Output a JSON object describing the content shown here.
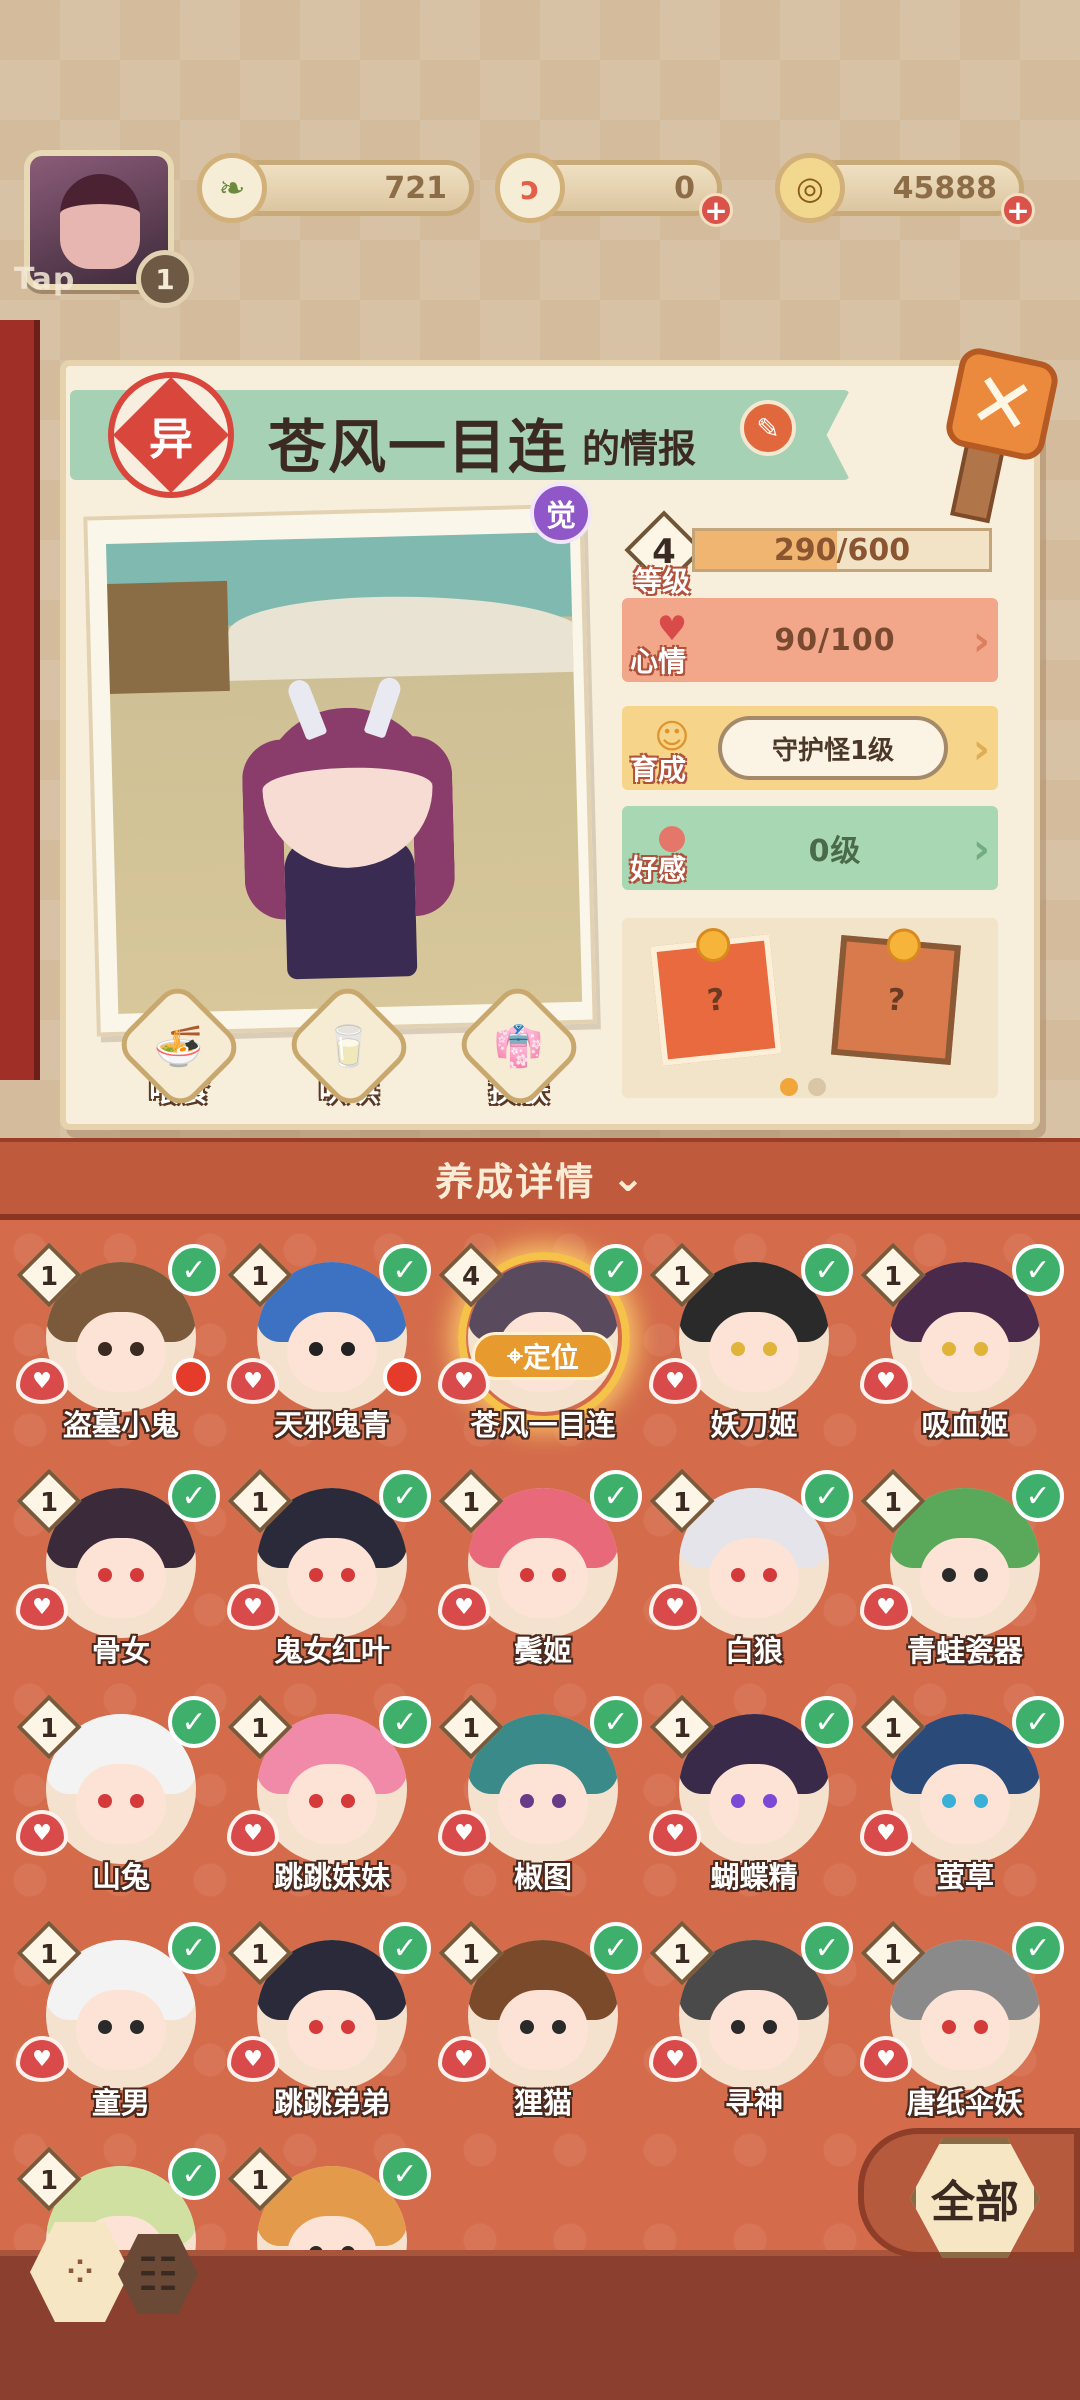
{
  "status": {
    "tap_label": "Tap",
    "player_level": "1",
    "resources": [
      {
        "name": "leaf",
        "icon": "leaf-currency-icon",
        "value": "721",
        "color": "#6c8a3c"
      },
      {
        "name": "magatama",
        "icon": "magatama-icon",
        "value": "0",
        "color": "#e2604a"
      },
      {
        "name": "coin",
        "icon": "coin-icon",
        "value": "45888",
        "color": "#c79a3c"
      }
    ]
  },
  "info": {
    "rarity_badge": "异",
    "name": "苍风一目连",
    "title_suffix": "的情报",
    "awaken_badge": "觉",
    "level": {
      "label": "等级",
      "value": "4",
      "exp": "290/600",
      "exp_fraction": 0.483
    },
    "mood": {
      "label": "心情",
      "value": "90/100"
    },
    "growth": {
      "label": "育成",
      "value": "守护怪1级"
    },
    "favor": {
      "label": "好感",
      "value": "0级"
    },
    "actions": [
      {
        "label": "喂食",
        "icon": "noodle-bowl-icon",
        "glyph": "🍜"
      },
      {
        "label": "哄哄",
        "icon": "milk-carton-icon",
        "glyph": "🥛"
      },
      {
        "label": "换肤",
        "icon": "kimono-icon",
        "glyph": "👘"
      }
    ],
    "gift_placeholder": "?",
    "pager_active": 0
  },
  "details_toggle": {
    "label": "养成详情"
  },
  "roster": [
    {
      "name": "盗墓小鬼",
      "level": "1",
      "hair": "#7a5a3a",
      "eye": "#3b2a22",
      "alert": true,
      "selected": false
    },
    {
      "name": "天邪鬼青",
      "level": "1",
      "hair": "#3d72c2",
      "eye": "#222222",
      "alert": true,
      "selected": false
    },
    {
      "name": "苍风一目连",
      "level": "4",
      "hair": "#5a4a5e",
      "eye": "#3b6fd6",
      "alert": false,
      "selected": true
    },
    {
      "name": "妖刀姬",
      "level": "1",
      "hair": "#2a2a2a",
      "eye": "#e0b43a",
      "alert": false,
      "selected": false
    },
    {
      "name": "吸血姬",
      "level": "1",
      "hair": "#4a2a4a",
      "eye": "#e0b43a",
      "alert": false,
      "selected": false
    },
    {
      "name": "骨女",
      "level": "1",
      "hair": "#3b2a3a",
      "eye": "#d43a3a",
      "alert": false,
      "selected": false
    },
    {
      "name": "鬼女红叶",
      "level": "1",
      "hair": "#2a2a3a",
      "eye": "#d43a3a",
      "alert": false,
      "selected": false
    },
    {
      "name": "鬓姬",
      "level": "1",
      "hair": "#e86a7a",
      "eye": "#d43a3a",
      "alert": false,
      "selected": false
    },
    {
      "name": "白狼",
      "level": "1",
      "hair": "#e4e4ea",
      "eye": "#d43a3a",
      "alert": false,
      "selected": false
    },
    {
      "name": "青蛙瓷器",
      "level": "1",
      "hair": "#5aa85a",
      "eye": "#2a2a2a",
      "alert": false,
      "selected": false
    },
    {
      "name": "山兔",
      "level": "1",
      "hair": "#f3f3f3",
      "eye": "#d43a3a",
      "alert": false,
      "selected": false
    },
    {
      "name": "跳跳妹妹",
      "level": "1",
      "hair": "#f08aa8",
      "eye": "#d43a3a",
      "alert": false,
      "selected": false
    },
    {
      "name": "椒图",
      "level": "1",
      "hair": "#3a8a8a",
      "eye": "#6a3a8a",
      "alert": false,
      "selected": false
    },
    {
      "name": "蝴蝶精",
      "level": "1",
      "hair": "#3a2a4a",
      "eye": "#7a4ad6",
      "alert": false,
      "selected": false
    },
    {
      "name": "萤草",
      "level": "1",
      "hair": "#2a4a7a",
      "eye": "#3ab0d6",
      "alert": false,
      "selected": false
    },
    {
      "name": "童男",
      "level": "1",
      "hair": "#f3f3f3",
      "eye": "#2a2a2a",
      "alert": false,
      "selected": false
    },
    {
      "name": "跳跳弟弟",
      "level": "1",
      "hair": "#2a2a3a",
      "eye": "#d43a3a",
      "alert": false,
      "selected": false
    },
    {
      "name": "狸猫",
      "level": "1",
      "hair": "#7a4a2a",
      "eye": "#2a2a2a",
      "alert": false,
      "selected": false
    },
    {
      "name": "寻神",
      "level": "1",
      "hair": "#4a4a4a",
      "eye": "#2a2a2a",
      "alert": false,
      "selected": false
    },
    {
      "name": "唐纸伞妖",
      "level": "1",
      "hair": "#8a8a8a",
      "eye": "#d43a3a",
      "alert": false,
      "selected": false
    },
    {
      "name": "",
      "level": "1",
      "hair": "#cfe0a0",
      "eye": "#2a2a2a",
      "alert": false,
      "selected": false
    },
    {
      "name": "",
      "level": "1",
      "hair": "#e39a4a",
      "eye": "#2a2a2a",
      "alert": false,
      "selected": false
    }
  ],
  "locate_label": "定位",
  "filter": {
    "all_label": "全部"
  },
  "colors": {
    "accent": "#d46c4b",
    "check": "#3eb06b"
  }
}
